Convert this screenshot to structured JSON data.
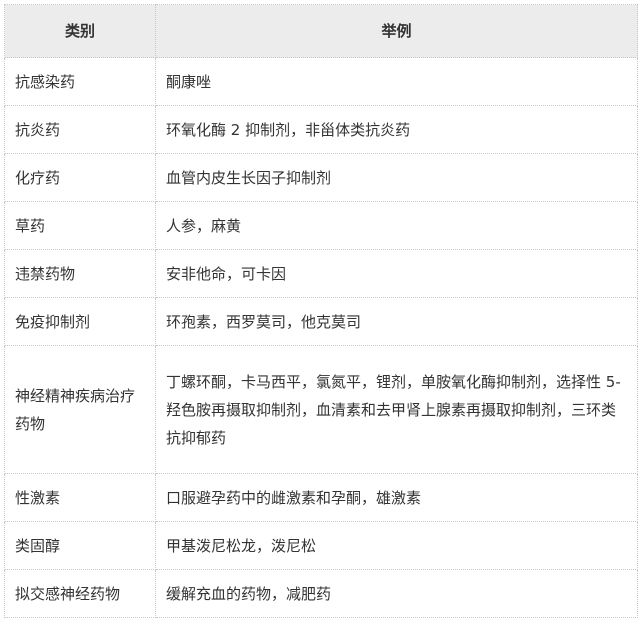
{
  "headers": [
    "类别",
    "举例"
  ],
  "rows": [
    [
      "抗感染药",
      "酮康唑"
    ],
    [
      "抗炎药",
      "环氧化酶 2 抑制剂，非甾体类抗炎药"
    ],
    [
      "化疗药",
      "血管内皮生长因子抑制剂"
    ],
    [
      "草药",
      "人参，麻黄"
    ],
    [
      "违禁药物",
      "安非他命，可卡因"
    ],
    [
      "免疫抑制剂",
      "环孢素，西罗莫司，他克莫司"
    ],
    [
      "神经精神疾病治疗药物",
      "丁螺环酮，卡马西平，氯氮平，锂剂，单胺氧化酶抑制剂，选择性 5-羟色胺再摄取抑制剂，血清素和去甲肾上腺素再摄取抑制剂，三环类抗抑郁药"
    ],
    [
      "性激素",
      "口服避孕药中的雌激素和孕酮，雄激素"
    ],
    [
      "类固醇",
      "甲基泼尼松龙，泼尼松"
    ],
    [
      "拟交感神经药物",
      "缓解充血的药物，减肥药"
    ]
  ]
}
